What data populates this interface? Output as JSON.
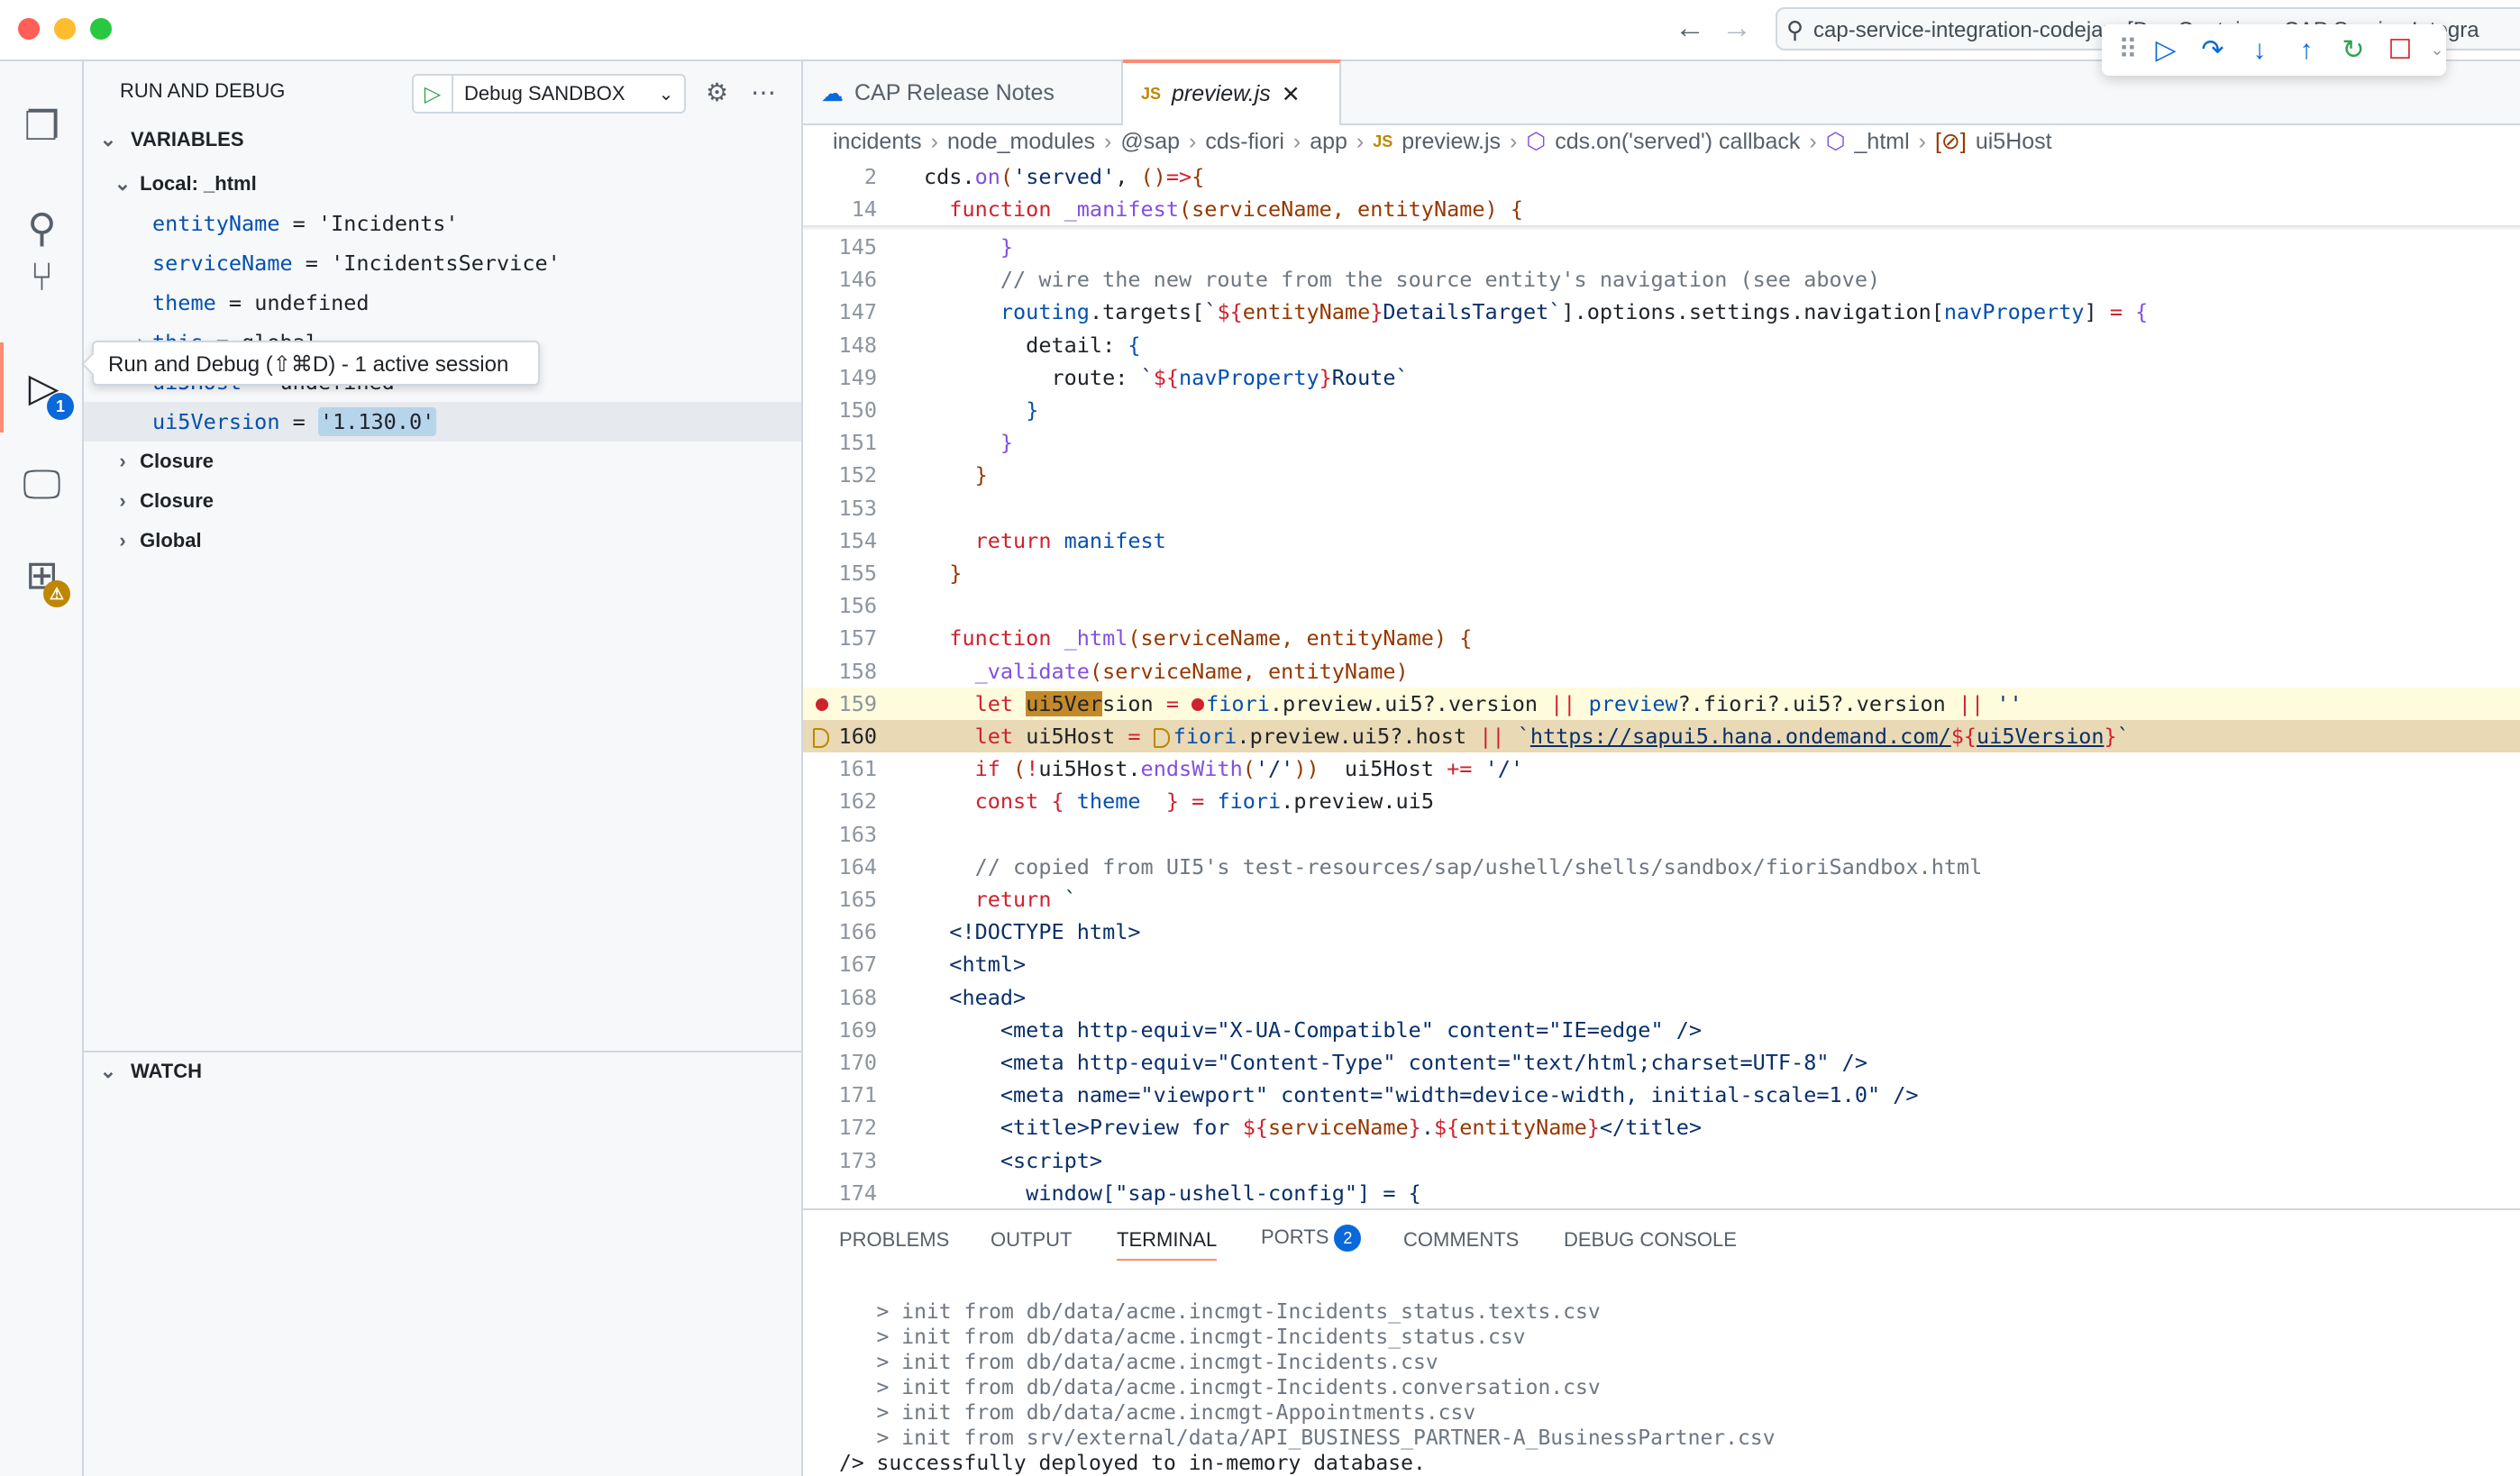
{
  "window": {
    "command_center": "cap-service-integration-codejam [Dev Container: CAP Service Integra",
    "traffic_lights": [
      "#ff5f57",
      "#febc2e",
      "#28c840"
    ]
  },
  "debug_toolbar": {
    "icons": [
      "drag-handle-icon",
      "continue-icon",
      "step-over-icon",
      "step-into-icon",
      "step-out-icon",
      "restart-icon",
      "stop-icon",
      "chevron-down-icon"
    ]
  },
  "activity_bar": {
    "items": [
      {
        "name": "explorer",
        "icon": "files-icon"
      },
      {
        "name": "search",
        "icon": "search-icon"
      },
      {
        "name": "source-control",
        "icon": "source-control-icon"
      },
      {
        "name": "run-and-debug",
        "icon": "debug-icon",
        "badge": "1",
        "active": true
      },
      {
        "name": "remote-explorer",
        "icon": "remote-explorer-icon"
      },
      {
        "name": "extensions",
        "icon": "extensions-icon",
        "badge": "⚠"
      }
    ],
    "tooltip": "Run and Debug (⇧⌘D) - 1 active session"
  },
  "sidebar": {
    "title": "RUN AND DEBUG",
    "launch_config": "Debug SANDBOX",
    "variables_header": "VARIABLES",
    "scope": "Local: _html",
    "variables": [
      {
        "name": "entityName",
        "value": "'Incidents'"
      },
      {
        "name": "serviceName",
        "value": "'IncidentsService'"
      },
      {
        "name": "theme",
        "value": "undefined"
      },
      {
        "name": "this",
        "value": "global"
      },
      {
        "name": "ui5Host",
        "value": "undefined"
      },
      {
        "name": "ui5Version",
        "value": "'1.130.0'"
      }
    ],
    "scopes": [
      "Closure",
      "Closure",
      "Global"
    ],
    "watch_header": "WATCH"
  },
  "tabs": [
    {
      "label": "CAP Release Notes",
      "icon": "release-notes-icon"
    },
    {
      "label": "preview.js",
      "icon_text": "JS",
      "active": true
    }
  ],
  "breadcrumb": [
    "incidents",
    "node_modules",
    "@sap",
    "cds-fiori",
    "app",
    "preview.js",
    "cds.on('served') callback",
    "_html",
    "ui5Host"
  ],
  "breadcrumb_icon_js": "JS",
  "editor": {
    "sticky": [
      {
        "n": "2",
        "t": [
          [
            "d",
            "cds."
          ],
          [
            "f",
            "on"
          ],
          [
            "p",
            "("
          ],
          [
            "s",
            "'served'"
          ],
          [
            "d",
            ", "
          ],
          [
            "p",
            "()"
          ],
          [
            "k",
            "=>"
          ],
          [
            "p",
            "{"
          ]
        ]
      },
      {
        "n": "14",
        "t": [
          [
            "d",
            "  "
          ],
          [
            "k",
            "function "
          ],
          [
            "f",
            "_manifest"
          ],
          [
            "p",
            "(serviceName, entityName) {"
          ]
        ]
      }
    ],
    "lines": [
      {
        "n": "145",
        "t": [
          [
            "d",
            "      "
          ],
          [
            "f",
            "}"
          ]
        ]
      },
      {
        "n": "146",
        "t": [
          [
            "c",
            "      // wire the new route from the source entity's navigation (see above)"
          ]
        ]
      },
      {
        "n": "147",
        "t": [
          [
            "d",
            "      "
          ],
          [
            "v",
            "routing"
          ],
          [
            "d",
            ".targets["
          ],
          [
            "s",
            "`"
          ],
          [
            "k",
            "${"
          ],
          [
            "p",
            "entityName"
          ],
          [
            "k",
            "}"
          ],
          [
            "s",
            "DetailsTarget`"
          ],
          [
            "d",
            "].options.settings.navigation["
          ],
          [
            "v",
            "navProperty"
          ],
          [
            "d",
            "] "
          ],
          [
            "k",
            "="
          ],
          [
            "d",
            " "
          ],
          [
            "f",
            "{"
          ]
        ]
      },
      {
        "n": "148",
        "t": [
          [
            "d",
            "        detail: "
          ],
          [
            "v",
            "{"
          ]
        ]
      },
      {
        "n": "149",
        "t": [
          [
            "d",
            "          route: "
          ],
          [
            "s",
            "`"
          ],
          [
            "k",
            "${"
          ],
          [
            "v",
            "navProperty"
          ],
          [
            "k",
            "}"
          ],
          [
            "s",
            "Route`"
          ]
        ]
      },
      {
        "n": "150",
        "t": [
          [
            "d",
            "        "
          ],
          [
            "v",
            "}"
          ]
        ]
      },
      {
        "n": "151",
        "t": [
          [
            "d",
            "      "
          ],
          [
            "f",
            "}"
          ]
        ]
      },
      {
        "n": "152",
        "t": [
          [
            "d",
            "    "
          ],
          [
            "p",
            "}"
          ]
        ]
      },
      {
        "n": "153",
        "t": []
      },
      {
        "n": "154",
        "t": [
          [
            "d",
            "    "
          ],
          [
            "k",
            "return "
          ],
          [
            "v",
            "manifest"
          ]
        ]
      },
      {
        "n": "155",
        "t": [
          [
            "d",
            "  "
          ],
          [
            "p",
            "}"
          ]
        ]
      },
      {
        "n": "156",
        "t": []
      },
      {
        "n": "157",
        "t": [
          [
            "d",
            "  "
          ],
          [
            "k",
            "function "
          ],
          [
            "f",
            "_html"
          ],
          [
            "p",
            "(serviceName, entityName) {"
          ]
        ]
      },
      {
        "n": "158",
        "t": [
          [
            "d",
            "    "
          ],
          [
            "f",
            "_validate"
          ],
          [
            "p",
            "(serviceName, entityName)"
          ]
        ]
      },
      {
        "n": "159",
        "bp": "breakpoint",
        "t": [
          [
            "d",
            "    "
          ],
          [
            "k",
            "let "
          ],
          [
            "hl",
            "ui5Ver"
          ],
          [
            "d",
            "sion "
          ],
          [
            "k",
            "= "
          ],
          [
            "bpdot",
            ""
          ],
          [
            "v",
            "fiori"
          ],
          [
            "d",
            ".preview.ui5?.version "
          ],
          [
            "k",
            "|| "
          ],
          [
            "v",
            "preview"
          ],
          [
            "d",
            "?.fiori?.ui5?.version "
          ],
          [
            "k",
            "|| "
          ],
          [
            "s",
            "''"
          ]
        ]
      },
      {
        "n": "160",
        "bp": "current",
        "t": [
          [
            "d",
            "    "
          ],
          [
            "k",
            "let "
          ],
          [
            "d",
            "ui5Host "
          ],
          [
            "k",
            "= "
          ],
          [
            "bparrow",
            ""
          ],
          [
            "v",
            "fiori"
          ],
          [
            "d",
            ".preview.ui5?.host "
          ],
          [
            "k",
            "|| "
          ],
          [
            "s",
            "`"
          ],
          [
            "url",
            "https://sapui5.hana.ondemand.com/"
          ],
          [
            "k",
            "${"
          ],
          [
            "url",
            "ui5Version"
          ],
          [
            "k",
            "}"
          ],
          [
            "s",
            "`"
          ]
        ]
      },
      {
        "n": "161",
        "t": [
          [
            "d",
            "    "
          ],
          [
            "k",
            "if "
          ],
          [
            "p",
            "("
          ],
          [
            "k",
            "!"
          ],
          [
            "d",
            "ui5Host."
          ],
          [
            "f",
            "endsWith"
          ],
          [
            "p",
            "("
          ],
          [
            "s",
            "'/'"
          ],
          [
            "p",
            "))"
          ],
          [
            "d",
            "  ui5Host "
          ],
          [
            "k",
            "+="
          ],
          [
            "d",
            " "
          ],
          [
            "s",
            "'/'"
          ]
        ]
      },
      {
        "n": "162",
        "t": [
          [
            "d",
            "    "
          ],
          [
            "k",
            "const "
          ],
          [
            "k",
            "{ "
          ],
          [
            "v",
            "theme"
          ],
          [
            "d",
            "  "
          ],
          [
            "k",
            "}"
          ],
          [
            "d",
            " "
          ],
          [
            "k",
            "="
          ],
          [
            "d",
            " "
          ],
          [
            "v",
            "fiori"
          ],
          [
            "d",
            ".preview.ui5"
          ]
        ]
      },
      {
        "n": "163",
        "t": []
      },
      {
        "n": "164",
        "t": [
          [
            "c",
            "    // copied from UI5's test-resources/sap/ushell/shells/sandbox/fioriSandbox.html"
          ]
        ]
      },
      {
        "n": "165",
        "t": [
          [
            "d",
            "    "
          ],
          [
            "k",
            "return "
          ],
          [
            "s",
            "`"
          ]
        ]
      },
      {
        "n": "166",
        "t": [
          [
            "s",
            "  <!DOCTYPE html>"
          ]
        ]
      },
      {
        "n": "167",
        "t": [
          [
            "s",
            "  <html>"
          ]
        ]
      },
      {
        "n": "168",
        "t": [
          [
            "s",
            "  <head>"
          ]
        ]
      },
      {
        "n": "169",
        "t": [
          [
            "s",
            "      <meta http-equiv=\"X-UA-Compatible\" content=\"IE=edge\" />"
          ]
        ]
      },
      {
        "n": "170",
        "t": [
          [
            "s",
            "      <meta http-equiv=\"Content-Type\" content=\"text/html;charset=UTF-8\" />"
          ]
        ]
      },
      {
        "n": "171",
        "t": [
          [
            "s",
            "      <meta name=\"viewport\" content=\"width=device-width, initial-scale=1.0\" />"
          ]
        ]
      },
      {
        "n": "172",
        "t": [
          [
            "s",
            "      <title>Preview for "
          ],
          [
            "k",
            "${"
          ],
          [
            "p",
            "serviceName"
          ],
          [
            "k",
            "}"
          ],
          [
            "s",
            "."
          ],
          [
            "k",
            "${"
          ],
          [
            "p",
            "entityName"
          ],
          [
            "k",
            "}"
          ],
          [
            "s",
            "</title>"
          ]
        ]
      },
      {
        "n": "173",
        "t": [
          [
            "s",
            "      <script>"
          ]
        ]
      },
      {
        "n": "174",
        "t": [
          [
            "s",
            "        window[\"sap-ushell-config\"] = {"
          ]
        ]
      }
    ]
  },
  "panel": {
    "tabs": [
      {
        "label": "PROBLEMS"
      },
      {
        "label": "OUTPUT"
      },
      {
        "label": "TERMINAL",
        "active": true
      },
      {
        "label": "PORTS",
        "badge": "2"
      },
      {
        "label": "COMMENTS"
      },
      {
        "label": "DEBUG CONSOLE"
      }
    ],
    "terminal": [
      "   > init from db/data/acme.incmgt-Incidents_status.texts.csv",
      "   > init from db/data/acme.incmgt-Incidents_status.csv",
      "   > init from db/data/acme.incmgt-Incidents.csv",
      "   > init from db/data/acme.incmgt-Incidents.conversation.csv",
      "   > init from db/data/acme.incmgt-Appointments.csv",
      "   > init from srv/external/data/API_BUSINESS_PARTNER-A_BusinessPartner.csv",
      "/> successfully deployed to in-memory database."
    ]
  }
}
